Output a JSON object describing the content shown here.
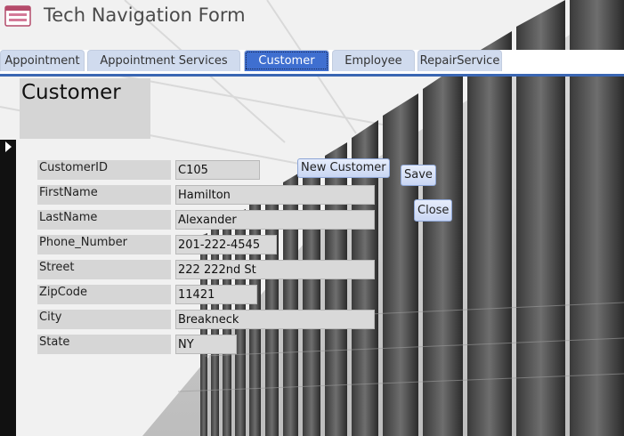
{
  "app": {
    "title": "Tech Navigation Form"
  },
  "tabs": [
    {
      "label": "Appointment",
      "active": false
    },
    {
      "label": "Appointment Services",
      "active": false
    },
    {
      "label": "Customer",
      "active": true
    },
    {
      "label": "Employee",
      "active": false
    },
    {
      "label": "RepairService",
      "active": false
    }
  ],
  "form": {
    "title": "Customer",
    "fields": [
      {
        "label": "CustomerID",
        "value": "C105"
      },
      {
        "label": "FirstName",
        "value": "Hamilton"
      },
      {
        "label": "LastName",
        "value": "Alexander"
      },
      {
        "label": "Phone_Number",
        "value": "201-222-4545"
      },
      {
        "label": "Street",
        "value": "222 222nd St"
      },
      {
        "label": "ZipCode",
        "value": "11421"
      },
      {
        "label": "City",
        "value": "Breakneck"
      },
      {
        "label": "State",
        "value": "NY"
      }
    ],
    "buttons": {
      "new_customer": "New Customer",
      "save": "Save",
      "close": "Close"
    }
  },
  "colors": {
    "accent": "#3f6fd0",
    "tab_inactive": "#d0dbee",
    "selector": "#111111"
  },
  "icons": {
    "form": "form-icon",
    "record_selector": "record-selector-arrow-icon"
  }
}
